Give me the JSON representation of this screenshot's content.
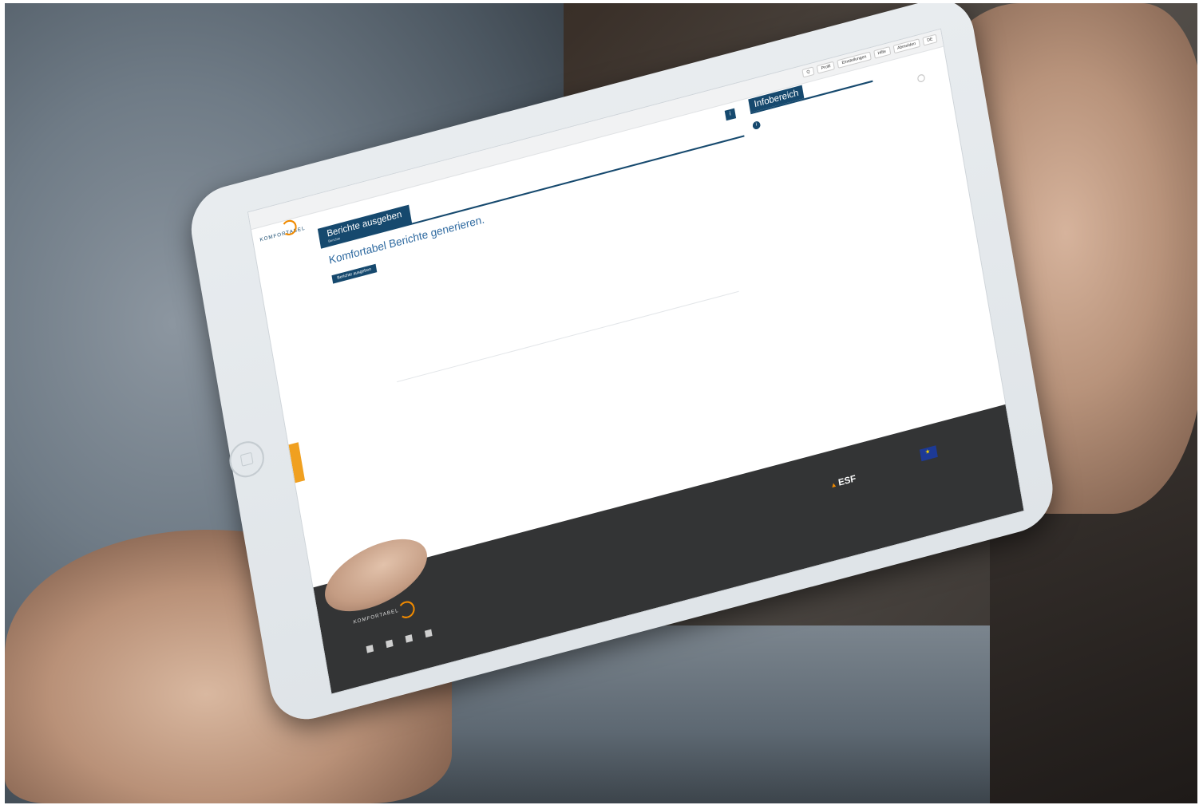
{
  "screen": {
    "topnav": [
      "Q",
      "Profil",
      "Einstellungen",
      "Hilfe",
      "Abmelden",
      "DE"
    ],
    "logo": "KOMFORTABEL",
    "tab": {
      "title": "Berichte ausgeben",
      "subtitle": "Berichte"
    },
    "mini_icon": "i",
    "main": {
      "title": "Komfortabel Berichte generieren.",
      "button": "Berichte ausgeben",
      "intro": "",
      "note": ""
    },
    "sidebar": {
      "title": "Infobereich",
      "subtitle": "",
      "items": [
        {
          "title": "",
          "text": "",
          "more": ""
        },
        {
          "title": "",
          "text": "",
          "more": ""
        },
        {
          "title": "",
          "text": "",
          "more": ""
        }
      ]
    },
    "footer": {
      "logo": "KOMFORTABEL",
      "nav": [
        "",
        "",
        "",
        "",
        ""
      ],
      "address": [
        "",
        ""
      ],
      "contact": [
        "",
        ""
      ],
      "contact2": [
        "",
        ""
      ],
      "funding_label": "",
      "esf": "ESF"
    }
  },
  "colors": {
    "brand_blue": "#16496e",
    "accent_orange": "#f08a00",
    "footer_bg": "#333435"
  }
}
